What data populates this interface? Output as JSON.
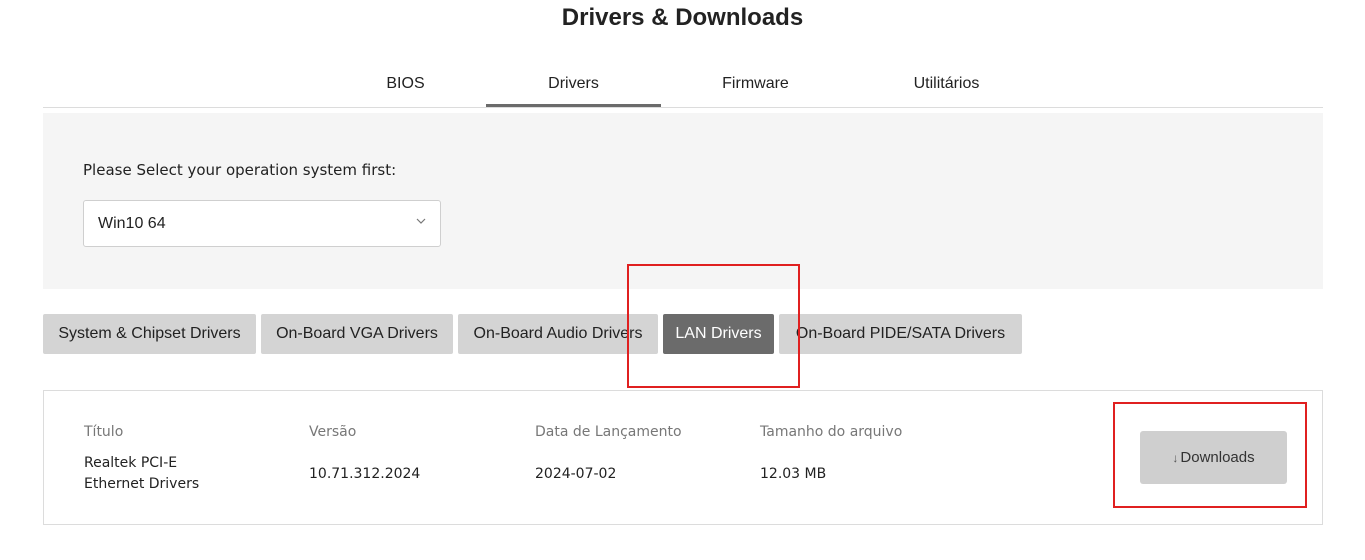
{
  "page": {
    "title": "Drivers & Downloads"
  },
  "tabs": [
    {
      "label": "BIOS"
    },
    {
      "label": "Drivers"
    },
    {
      "label": "Firmware"
    },
    {
      "label": "Utilitários"
    }
  ],
  "active_tab": "Drivers",
  "os": {
    "label": "Please Select your operation system first:",
    "selected": "Win10 64"
  },
  "categories": [
    {
      "label": "System & Chipset Drivers"
    },
    {
      "label": "On-Board VGA Drivers"
    },
    {
      "label": "On-Board Audio Drivers"
    },
    {
      "label": "LAN Drivers"
    },
    {
      "label": "On-Board PIDE/SATA Drivers"
    }
  ],
  "active_category": "LAN Drivers",
  "table": {
    "headers": {
      "title": "Título",
      "version": "Versão",
      "release_date": "Data de Lançamento",
      "file_size": "Tamanho do arquivo"
    },
    "row": {
      "title_line1": "Realtek PCI-E",
      "title_line2": "Ethernet Drivers",
      "version": "10.71.312.2024",
      "release_date": "2024-07-02",
      "file_size": "12.03 MB"
    },
    "download_label": "Downloads"
  },
  "colors": {
    "highlight_box": "#e02020",
    "active_tab_underline": "#6b6b6b",
    "active_category_bg": "#6b6b6b",
    "category_bg": "#d4d4d4"
  }
}
